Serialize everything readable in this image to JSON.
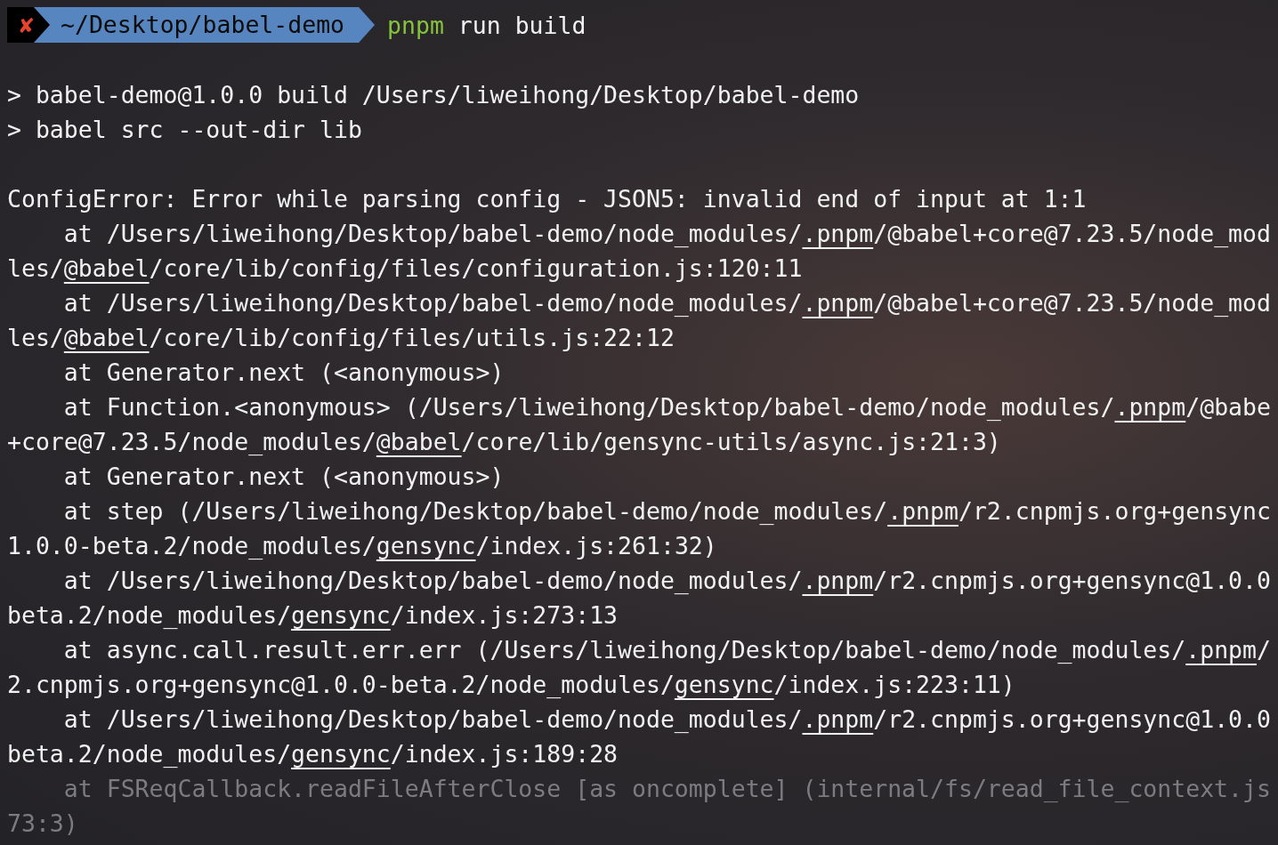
{
  "prompt": {
    "status": "✘",
    "path": "~/Desktop/babel-demo",
    "command": "pnpm",
    "args": " run build"
  },
  "lines": [
    {
      "kind": "blank"
    },
    {
      "kind": "output",
      "segments": [
        {
          "text": "> babel-demo@1.0.0 build /Users/liweihong/Desktop/babel-demo",
          "link": false
        }
      ]
    },
    {
      "kind": "output",
      "segments": [
        {
          "text": "> babel src --out-dir lib",
          "link": false
        }
      ]
    },
    {
      "kind": "blank"
    },
    {
      "kind": "output",
      "segments": [
        {
          "text": "ConfigError: Error while parsing config - JSON5: invalid end of input at 1:1",
          "link": false
        }
      ]
    },
    {
      "kind": "output",
      "segments": [
        {
          "text": "    at /Users/liweihong/Desktop/babel-demo/node_modules/",
          "link": false
        },
        {
          "text": ".pnpm",
          "link": true
        },
        {
          "text": "/@babel+core@7.23.5/node_mod",
          "link": false
        }
      ]
    },
    {
      "kind": "output",
      "segments": [
        {
          "text": "les/",
          "link": false
        },
        {
          "text": "@babel",
          "link": true
        },
        {
          "text": "/core/lib/config/files/configuration.js:120:11",
          "link": false
        }
      ]
    },
    {
      "kind": "output",
      "segments": [
        {
          "text": "    at /Users/liweihong/Desktop/babel-demo/node_modules/",
          "link": false
        },
        {
          "text": ".pnpm",
          "link": true
        },
        {
          "text": "/@babel+core@7.23.5/node_mod",
          "link": false
        }
      ]
    },
    {
      "kind": "output",
      "segments": [
        {
          "text": "les/",
          "link": false
        },
        {
          "text": "@babel",
          "link": true
        },
        {
          "text": "/core/lib/config/files/utils.js:22:12",
          "link": false
        }
      ]
    },
    {
      "kind": "output",
      "segments": [
        {
          "text": "    at Generator.next (<anonymous>)",
          "link": false
        }
      ]
    },
    {
      "kind": "output",
      "segments": [
        {
          "text": "    at Function.<anonymous> (/Users/liweihong/Desktop/babel-demo/node_modules/",
          "link": false
        },
        {
          "text": ".pnpm",
          "link": true
        },
        {
          "text": "/@babe",
          "link": false
        }
      ]
    },
    {
      "kind": "output",
      "segments": [
        {
          "text": "+core@7.23.5/node_modules/",
          "link": false
        },
        {
          "text": "@babel",
          "link": true
        },
        {
          "text": "/core/lib/gensync-utils/async.js:21:3)",
          "link": false
        }
      ]
    },
    {
      "kind": "output",
      "segments": [
        {
          "text": "    at Generator.next (<anonymous>)",
          "link": false
        }
      ]
    },
    {
      "kind": "output",
      "segments": [
        {
          "text": "    at step (/Users/liweihong/Desktop/babel-demo/node_modules/",
          "link": false
        },
        {
          "text": ".pnpm",
          "link": true
        },
        {
          "text": "/r2.cnpmjs.org+gensync",
          "link": false
        }
      ]
    },
    {
      "kind": "output",
      "segments": [
        {
          "text": "1.0.0-beta.2/node_modules/",
          "link": false
        },
        {
          "text": "gensync",
          "link": true
        },
        {
          "text": "/index.js:261:32)",
          "link": false
        }
      ]
    },
    {
      "kind": "output",
      "segments": [
        {
          "text": "    at /Users/liweihong/Desktop/babel-demo/node_modules/",
          "link": false
        },
        {
          "text": ".pnpm",
          "link": true
        },
        {
          "text": "/r2.cnpmjs.org+gensync@1.0.0",
          "link": false
        }
      ]
    },
    {
      "kind": "output",
      "segments": [
        {
          "text": "beta.2/node_modules/",
          "link": false
        },
        {
          "text": "gensync",
          "link": true
        },
        {
          "text": "/index.js:273:13",
          "link": false
        }
      ]
    },
    {
      "kind": "output",
      "segments": [
        {
          "text": "    at async.call.result.err.err (/Users/liweihong/Desktop/babel-demo/node_modules/",
          "link": false
        },
        {
          "text": ".pnpm",
          "link": true
        },
        {
          "text": "/",
          "link": false
        }
      ]
    },
    {
      "kind": "output",
      "segments": [
        {
          "text": "2.cnpmjs.org+gensync@1.0.0-beta.2/node_modules/",
          "link": false
        },
        {
          "text": "gensync",
          "link": true
        },
        {
          "text": "/index.js:223:11)",
          "link": false
        }
      ]
    },
    {
      "kind": "output",
      "segments": [
        {
          "text": "    at /Users/liweihong/Desktop/babel-demo/node_modules/",
          "link": false
        },
        {
          "text": ".pnpm",
          "link": true
        },
        {
          "text": "/r2.cnpmjs.org+gensync@1.0.0",
          "link": false
        }
      ]
    },
    {
      "kind": "output",
      "segments": [
        {
          "text": "beta.2/node_modules/",
          "link": false
        },
        {
          "text": "gensync",
          "link": true
        },
        {
          "text": "/index.js:189:28",
          "link": false
        }
      ]
    },
    {
      "kind": "faded",
      "segments": [
        {
          "text": "    at FSReqCallback.readFileAfterClose [as oncomplete] (internal/fs/read_file_context.js",
          "link": false
        }
      ]
    },
    {
      "kind": "faded",
      "segments": [
        {
          "text": "73:3)",
          "link": false
        }
      ]
    }
  ]
}
